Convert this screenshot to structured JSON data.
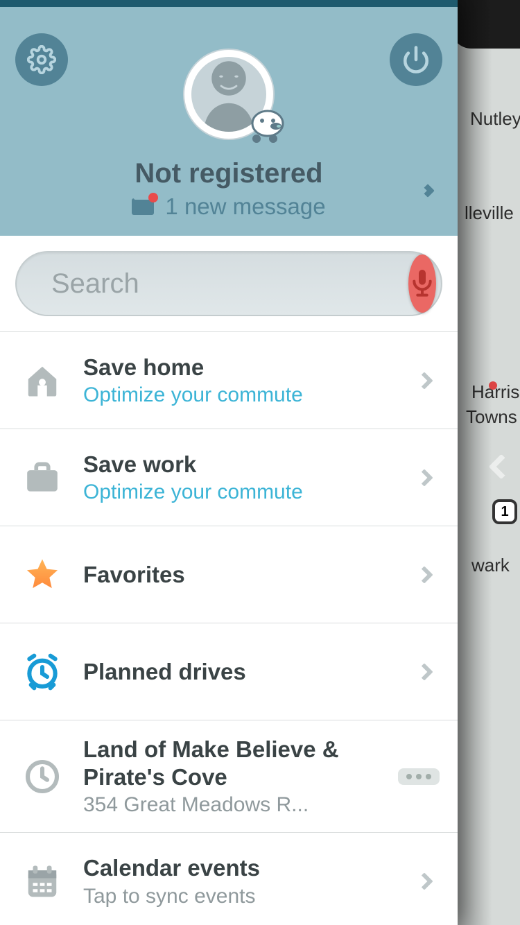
{
  "map": {
    "labels": [
      "Nutley",
      "lleville",
      "Harris",
      "Towns",
      "wark"
    ],
    "route_num": "1"
  },
  "header": {
    "user_title": "Not registered",
    "inbox_text": "1 new message"
  },
  "search": {
    "placeholder": "Search"
  },
  "rows": {
    "home": {
      "title": "Save home",
      "sub": "Optimize your commute"
    },
    "work": {
      "title": "Save work",
      "sub": "Optimize your commute"
    },
    "fav": {
      "title": "Favorites"
    },
    "plan": {
      "title": "Planned drives"
    },
    "recent": {
      "title": "Land of Make Believe & Pirate's Cove",
      "sub": "354 Great Meadows R..."
    },
    "cal": {
      "title": "Calendar events",
      "sub": "Tap to sync events"
    }
  }
}
